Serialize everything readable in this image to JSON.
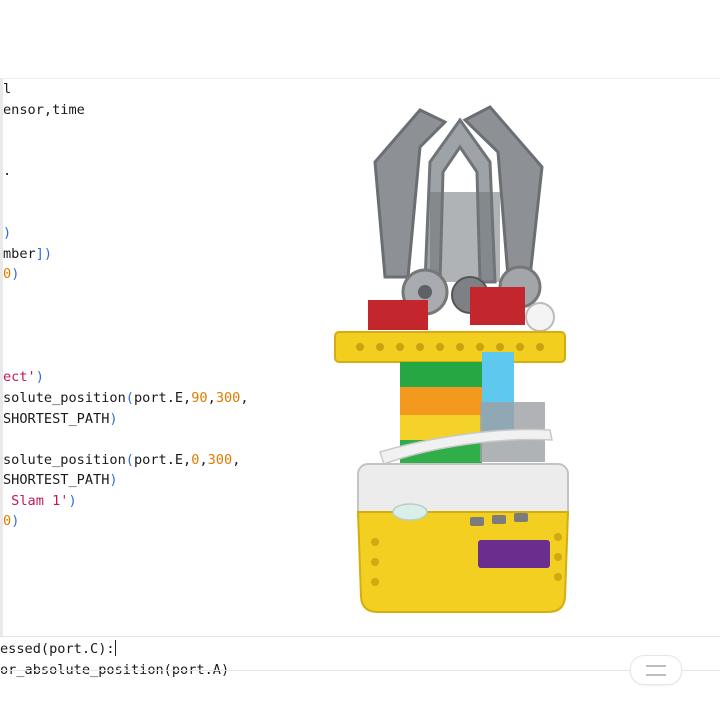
{
  "editor": {
    "code_lines": [
      [
        {
          "t": "plain",
          "v": "l"
        }
      ],
      [
        {
          "t": "plain",
          "v": "ensor,time"
        }
      ],
      [],
      [],
      [
        {
          "t": "plain",
          "v": "."
        }
      ],
      [],
      [],
      [
        {
          "t": "paren",
          "v": ")"
        }
      ],
      [
        {
          "t": "plain",
          "v": "mber"
        },
        {
          "t": "paren",
          "v": "])"
        }
      ],
      [
        {
          "t": "num",
          "v": "0"
        },
        {
          "t": "paren",
          "v": ")"
        }
      ],
      [],
      [],
      [],
      [],
      [
        {
          "t": "str",
          "v": "ect'"
        },
        {
          "t": "paren",
          "v": ")"
        }
      ],
      [
        {
          "t": "plain",
          "v": "solute_position"
        },
        {
          "t": "paren",
          "v": "("
        },
        {
          "t": "plain",
          "v": "port.E,"
        },
        {
          "t": "num",
          "v": "90"
        },
        {
          "t": "plain",
          "v": ","
        },
        {
          "t": "num",
          "v": "300"
        },
        {
          "t": "plain",
          "v": ","
        }
      ],
      [
        {
          "t": "plain",
          "v": "SHORTEST_PATH"
        },
        {
          "t": "paren",
          "v": ")"
        }
      ],
      [],
      [
        {
          "t": "plain",
          "v": "solute_position"
        },
        {
          "t": "paren",
          "v": "("
        },
        {
          "t": "plain",
          "v": "port.E,"
        },
        {
          "t": "num",
          "v": "0"
        },
        {
          "t": "plain",
          "v": ","
        },
        {
          "t": "num",
          "v": "300"
        },
        {
          "t": "plain",
          "v": ","
        }
      ],
      [
        {
          "t": "plain",
          "v": "SHORTEST_PATH"
        },
        {
          "t": "paren",
          "v": ")"
        }
      ],
      [
        {
          "t": "str",
          "v": " Slam 1'"
        },
        {
          "t": "paren",
          "v": ")"
        }
      ],
      [
        {
          "t": "num",
          "v": "0"
        },
        {
          "t": "paren",
          "v": ")"
        }
      ]
    ]
  },
  "bottom": {
    "line1": "essed(port.C):",
    "line2": "or_absolute_position(port.A)"
  },
  "colors": {
    "string": "#c2185b",
    "number": "#e07b00",
    "paren": "#2e6fd6",
    "text": "#1a1a1a"
  }
}
